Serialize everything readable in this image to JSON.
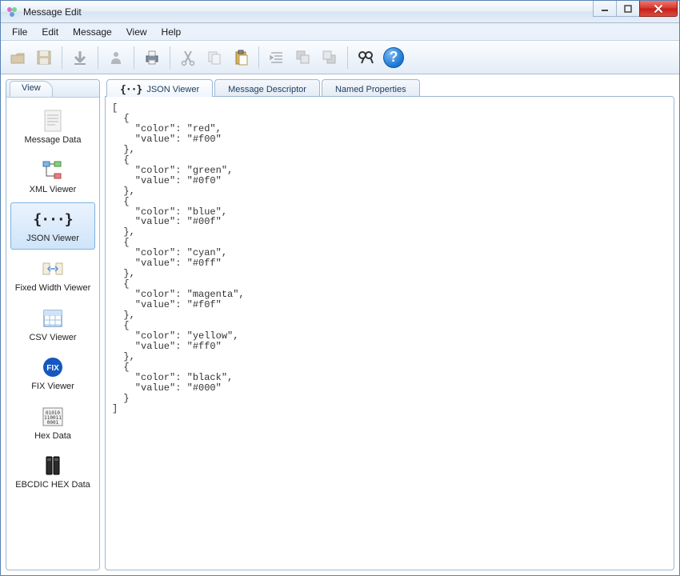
{
  "window": {
    "title": "Message Edit"
  },
  "menubar": {
    "items": [
      "File",
      "Edit",
      "Message",
      "View",
      "Help"
    ]
  },
  "sidebar": {
    "tab_label": "View",
    "items": [
      {
        "label": "Message Data",
        "icon": "doc-icon"
      },
      {
        "label": "XML Viewer",
        "icon": "tree-icon"
      },
      {
        "label": "JSON Viewer",
        "icon": "json-icon",
        "selected": true
      },
      {
        "label": "Fixed Width Viewer",
        "icon": "fixedwidth-icon"
      },
      {
        "label": "CSV Viewer",
        "icon": "grid-icon"
      },
      {
        "label": "FIX Viewer",
        "icon": "fix-icon"
      },
      {
        "label": "Hex Data",
        "icon": "hex-icon"
      },
      {
        "label": "EBCDIC HEX Data",
        "icon": "server-icon"
      }
    ]
  },
  "main": {
    "tabs": [
      {
        "label": "JSON Viewer",
        "active": true,
        "icon": "json-icon"
      },
      {
        "label": "Message Descriptor"
      },
      {
        "label": "Named Properties"
      }
    ],
    "json_text": "[\n  {\n    \"color\": \"red\",\n    \"value\": \"#f00\"\n  },\n  {\n    \"color\": \"green\",\n    \"value\": \"#0f0\"\n  },\n  {\n    \"color\": \"blue\",\n    \"value\": \"#00f\"\n  },\n  {\n    \"color\": \"cyan\",\n    \"value\": \"#0ff\"\n  },\n  {\n    \"color\": \"magenta\",\n    \"value\": \"#f0f\"\n  },\n  {\n    \"color\": \"yellow\",\n    \"value\": \"#ff0\"\n  },\n  {\n    \"color\": \"black\",\n    \"value\": \"#000\"\n  }\n]"
  },
  "help": {
    "symbol": "?"
  }
}
